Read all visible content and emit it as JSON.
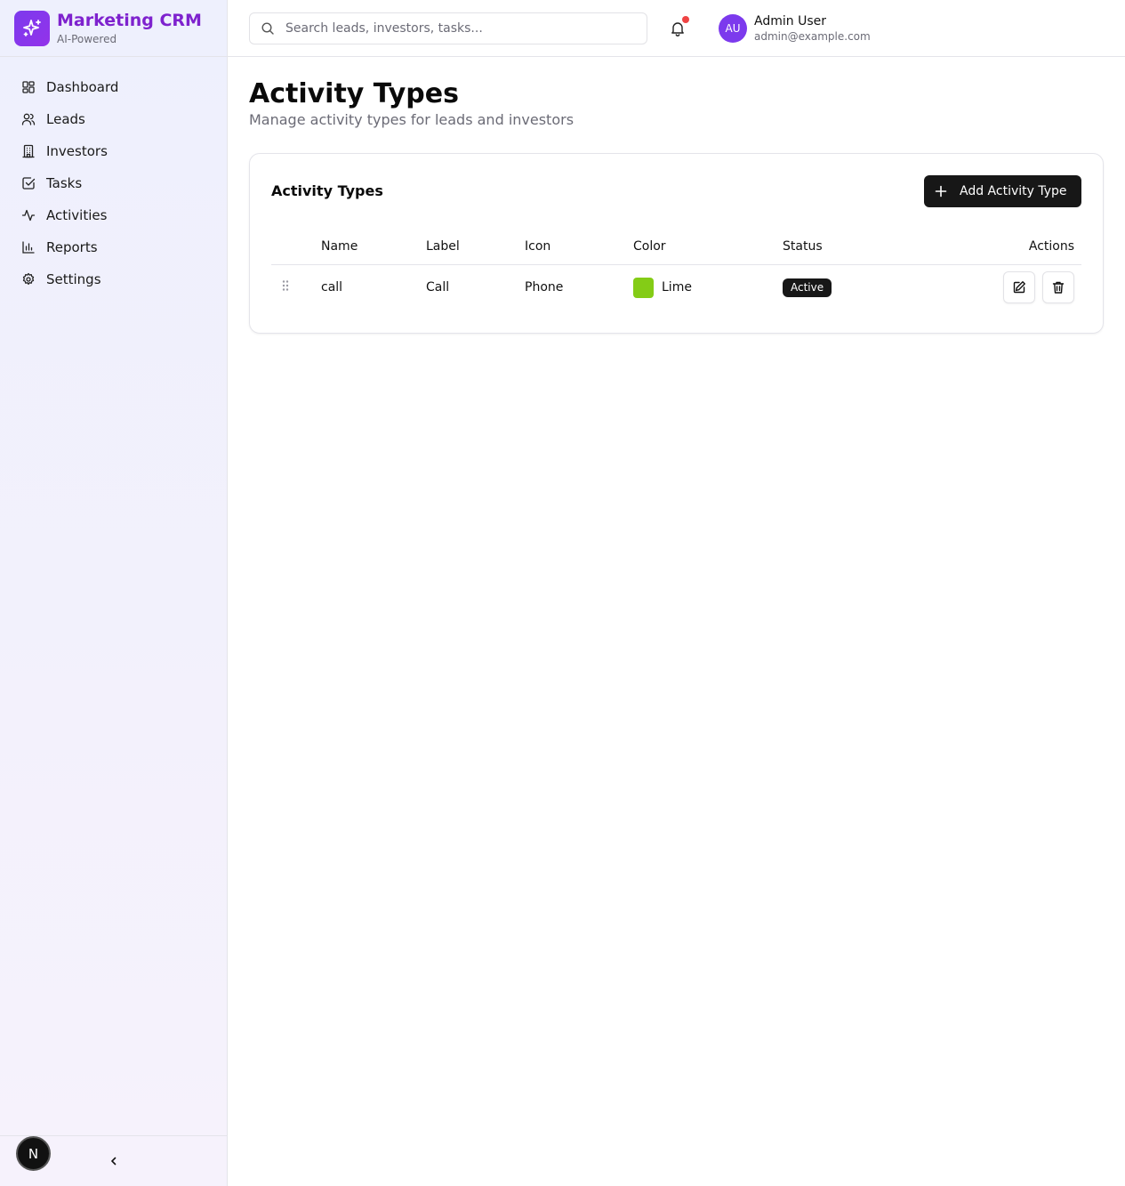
{
  "brand": {
    "title": "Marketing CRM",
    "subtitle": "AI-Powered",
    "logo_icon": "sparkles-icon",
    "color": "#7e22ce"
  },
  "sidebar": {
    "items": [
      {
        "label": "Dashboard",
        "icon": "dashboard-icon"
      },
      {
        "label": "Leads",
        "icon": "users-icon"
      },
      {
        "label": "Investors",
        "icon": "building-icon"
      },
      {
        "label": "Tasks",
        "icon": "checkbox-icon"
      },
      {
        "label": "Activities",
        "icon": "activity-icon"
      },
      {
        "label": "Reports",
        "icon": "bar-chart-icon"
      },
      {
        "label": "Settings",
        "icon": "gear-icon"
      }
    ],
    "footer_badge": "N"
  },
  "header": {
    "search_placeholder": "Search leads, investors, tasks...",
    "user": {
      "initials": "AU",
      "name": "Admin User",
      "email": "admin@example.com"
    }
  },
  "page": {
    "title": "Activity Types",
    "subtitle": "Manage activity types for leads and investors"
  },
  "card": {
    "title": "Activity Types",
    "add_button_label": "Add Activity Type",
    "columns": [
      "Name",
      "Label",
      "Icon",
      "Color",
      "Status",
      "Actions"
    ],
    "rows": [
      {
        "name": "call",
        "label": "Call",
        "icon": "Phone",
        "color_name": "Lime",
        "color_hex": "#84cc16",
        "status": "Active"
      }
    ]
  }
}
